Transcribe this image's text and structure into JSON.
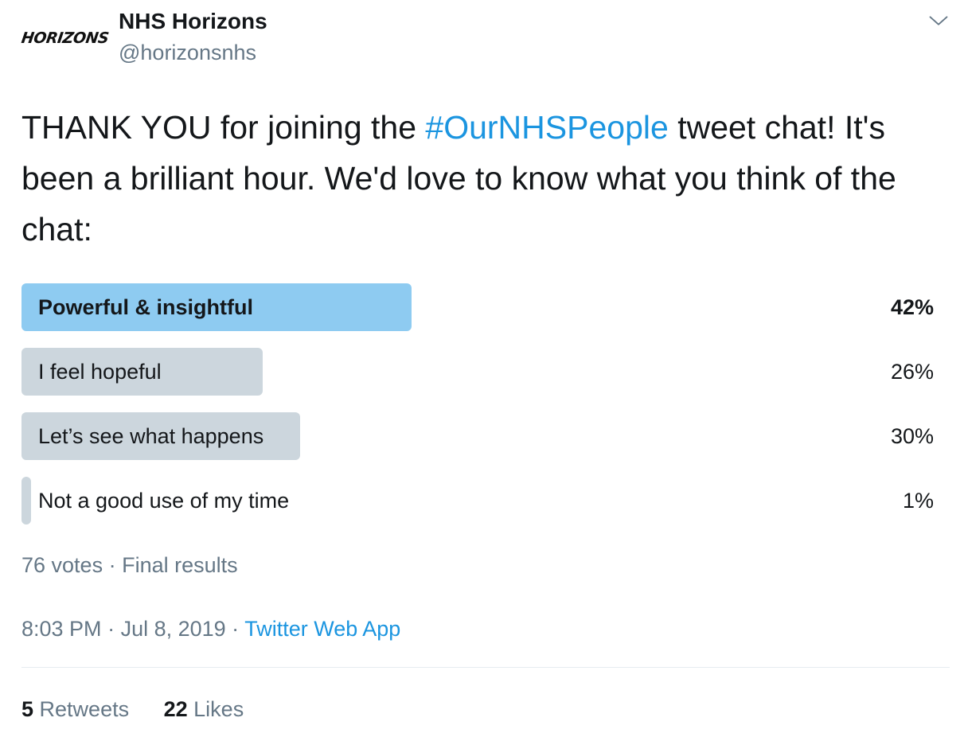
{
  "author": {
    "avatar_text": "HORIZONS",
    "display_name": "NHS Horizons",
    "handle": "@horizonsnhs"
  },
  "tweet": {
    "text_before": "THANK YOU for joining the ",
    "hashtag": "#OurNHSPeople",
    "text_after": " tweet chat! It's been a brilliant hour. We'd love to know what you think of the chat:"
  },
  "poll": {
    "options": [
      {
        "label": "Powerful & insightful",
        "percent": "42%",
        "fraction": 0.42,
        "winner": true
      },
      {
        "label": "I feel hopeful",
        "percent": "26%",
        "fraction": 0.26,
        "winner": false
      },
      {
        "label": "Let’s see what happens",
        "percent": "30%",
        "fraction": 0.3,
        "winner": false
      },
      {
        "label": "Not a good use of my time",
        "percent": "1%",
        "fraction": 0.01,
        "winner": false
      }
    ],
    "votes": "76 votes",
    "status": "Final results",
    "separator": " · "
  },
  "meta": {
    "time": "8:03 PM",
    "date": "Jul 8, 2019",
    "source": "Twitter Web App",
    "separator": " · "
  },
  "stats": {
    "retweets_count": "5",
    "retweets_label": " Retweets",
    "likes_count": "22",
    "likes_label": " Likes"
  },
  "colors": {
    "text": "#14171a",
    "secondary": "#657786",
    "link": "#1b95e0",
    "winner_bar": "#8ecbf1",
    "bar": "#ccd6dd"
  },
  "icons": {
    "menu": "chevron-down-icon"
  }
}
